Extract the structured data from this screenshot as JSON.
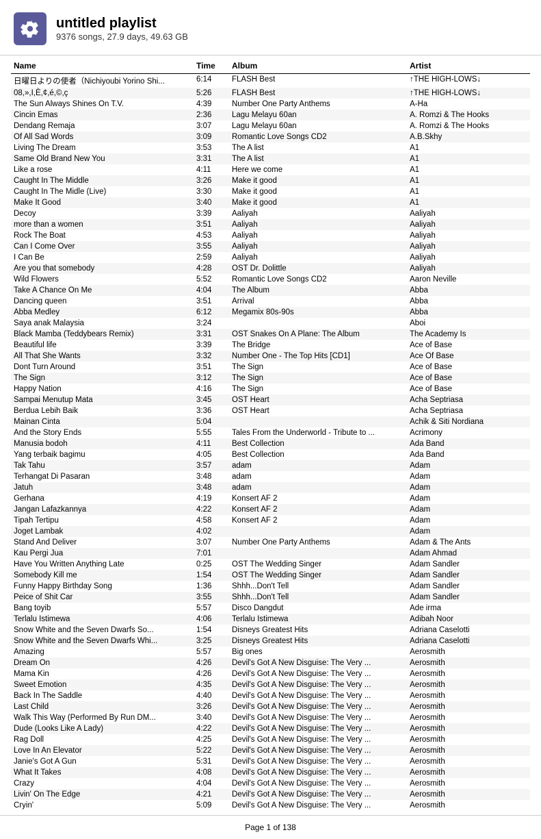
{
  "header": {
    "title": "untitled playlist",
    "subtitle": "9376 songs, 27.9 days, 49.63 GB"
  },
  "columns": {
    "name": "Name",
    "time": "Time",
    "album": "Album",
    "artist": "Artist"
  },
  "footer": "Page 1 of 138",
  "rows": [
    {
      "name": "日曜日よりの使者（Nichiyoubi Yorino Shi...",
      "time": "6:14",
      "album": "FLASH Best",
      "artist": "↑THE HIGH-LOWS↓"
    },
    {
      "name": "08,»,I,È,¢,é,©,ç",
      "time": "5:26",
      "album": "FLASH Best",
      "artist": "↑THE HIGH-LOWS↓"
    },
    {
      "name": "The Sun Always Shines On T.V.",
      "time": "4:39",
      "album": "Number One Party Anthems",
      "artist": "A-Ha"
    },
    {
      "name": "Cincin Emas",
      "time": "2:36",
      "album": "Lagu Melayu 60an",
      "artist": "A. Romzi & The Hooks"
    },
    {
      "name": "Dendang Remaja",
      "time": "3:07",
      "album": "Lagu Melayu 60an",
      "artist": "A. Romzi & The Hooks"
    },
    {
      "name": "Of All Sad Words",
      "time": "3:09",
      "album": "Romantic Love Songs CD2",
      "artist": "A.B.Skhy"
    },
    {
      "name": "Living The Dream",
      "time": "3:53",
      "album": "The A list",
      "artist": "A1"
    },
    {
      "name": "Same Old Brand New You",
      "time": "3:31",
      "album": "The A list",
      "artist": "A1"
    },
    {
      "name": "Like a rose",
      "time": "4:11",
      "album": "Here we come",
      "artist": "A1"
    },
    {
      "name": "Caught In The Middle",
      "time": "3:26",
      "album": "Make it good",
      "artist": "A1"
    },
    {
      "name": "Caught In The Midle (Live)",
      "time": "3:30",
      "album": "Make it good",
      "artist": "A1"
    },
    {
      "name": "Make It Good",
      "time": "3:40",
      "album": "Make it good",
      "artist": "A1"
    },
    {
      "name": "Decoy",
      "time": "3:39",
      "album": "Aaliyah",
      "artist": "Aaliyah"
    },
    {
      "name": "more than a women",
      "time": "3:51",
      "album": "Aaliyah",
      "artist": "Aaliyah"
    },
    {
      "name": "Rock The Boat",
      "time": "4:53",
      "album": "Aaliyah",
      "artist": "Aaliyah"
    },
    {
      "name": "Can I Come Over",
      "time": "3:55",
      "album": "Aaliyah",
      "artist": "Aaliyah"
    },
    {
      "name": "I Can Be",
      "time": "2:59",
      "album": "Aaliyah",
      "artist": "Aaliyah"
    },
    {
      "name": "Are you that somebody",
      "time": "4:28",
      "album": "OST Dr. Dolittle",
      "artist": "Aaliyah"
    },
    {
      "name": "Wild Flowers",
      "time": "5:52",
      "album": "Romantic Love Songs CD2",
      "artist": "Aaron Neville"
    },
    {
      "name": "Take A Chance On Me",
      "time": "4:04",
      "album": "The Album",
      "artist": "Abba"
    },
    {
      "name": "Dancing queen",
      "time": "3:51",
      "album": "Arrival",
      "artist": "Abba"
    },
    {
      "name": "Abba Medley",
      "time": "6:12",
      "album": "Megamix 80s-90s",
      "artist": "Abba"
    },
    {
      "name": "Saya anak Malaysia",
      "time": "3:24",
      "album": "",
      "artist": "Aboi"
    },
    {
      "name": "Black Mamba (Teddybears Remix)",
      "time": "3:31",
      "album": "OST Snakes On A Plane: The Album",
      "artist": "The Academy Is"
    },
    {
      "name": "Beautiful life",
      "time": "3:39",
      "album": "The Bridge",
      "artist": "Ace of Base"
    },
    {
      "name": "All That She Wants",
      "time": "3:32",
      "album": "Number One - The Top Hits [CD1]",
      "artist": "Ace Of Base"
    },
    {
      "name": "Dont Turn Around",
      "time": "3:51",
      "album": "The Sign",
      "artist": "Ace of Base"
    },
    {
      "name": "The Sign",
      "time": "3:12",
      "album": "The Sign",
      "artist": "Ace of Base"
    },
    {
      "name": "Happy Nation",
      "time": "4:16",
      "album": "The Sign",
      "artist": "Ace of Base"
    },
    {
      "name": "Sampai Menutup Mata",
      "time": "3:45",
      "album": "OST Heart",
      "artist": "Acha Septriasa"
    },
    {
      "name": "Berdua Lebih Baik",
      "time": "3:36",
      "album": "OST Heart",
      "artist": "Acha Septriasa"
    },
    {
      "name": "Mainan Cinta",
      "time": "5:04",
      "album": "",
      "artist": "Achik & Siti Nordiana"
    },
    {
      "name": "And the Story Ends",
      "time": "5:55",
      "album": "Tales From the Underworld - Tribute to ...",
      "artist": "Acrimony"
    },
    {
      "name": "Manusia bodoh",
      "time": "4:11",
      "album": "Best Collection",
      "artist": "Ada Band"
    },
    {
      "name": "Yang terbaik bagimu",
      "time": "4:05",
      "album": "Best Collection",
      "artist": "Ada Band"
    },
    {
      "name": "Tak Tahu",
      "time": "3:57",
      "album": "adam",
      "artist": "Adam"
    },
    {
      "name": "Terhangat Di Pasaran",
      "time": "3:48",
      "album": "adam",
      "artist": "Adam"
    },
    {
      "name": "Jatuh",
      "time": "3:48",
      "album": "adam",
      "artist": "Adam"
    },
    {
      "name": "Gerhana",
      "time": "4:19",
      "album": "Konsert AF 2",
      "artist": "Adam"
    },
    {
      "name": "Jangan Lafazkannya",
      "time": "4:22",
      "album": "Konsert AF 2",
      "artist": "Adam"
    },
    {
      "name": "Tipah Tertipu",
      "time": "4:58",
      "album": "Konsert AF 2",
      "artist": "Adam"
    },
    {
      "name": "Joget Lambak",
      "time": "4:02",
      "album": "",
      "artist": "Adam"
    },
    {
      "name": "Stand And Deliver",
      "time": "3:07",
      "album": "Number One Party Anthems",
      "artist": "Adam & The Ants"
    },
    {
      "name": "Kau Pergi Jua",
      "time": "7:01",
      "album": "",
      "artist": "Adam Ahmad"
    },
    {
      "name": "Have You Written Anything Late",
      "time": "0:25",
      "album": "OST The Wedding Singer",
      "artist": "Adam Sandler"
    },
    {
      "name": "Somebody Kill me",
      "time": "1:54",
      "album": "OST The Wedding Singer",
      "artist": "Adam Sandler"
    },
    {
      "name": "Funny Happy Birthday Song",
      "time": "1:36",
      "album": "Shhh...Don't Tell",
      "artist": "Adam Sandler"
    },
    {
      "name": "Peice of Shit Car",
      "time": "3:55",
      "album": "Shhh...Don't Tell",
      "artist": "Adam Sandler"
    },
    {
      "name": "Bang toyib",
      "time": "5:57",
      "album": "Disco Dangdut",
      "artist": "Ade irma"
    },
    {
      "name": "Terlalu Istimewa",
      "time": "4:06",
      "album": "Terlalu Istimewa",
      "artist": "Adibah Noor"
    },
    {
      "name": "Snow White and the Seven Dwarfs So...",
      "time": "1:54",
      "album": "Disneys Greatest Hits",
      "artist": "Adriana Caselotti"
    },
    {
      "name": "Snow White and the Seven Dwarfs Whi...",
      "time": "3:25",
      "album": "Disneys Greatest Hits",
      "artist": "Adriana Caselotti"
    },
    {
      "name": "Amazing",
      "time": "5:57",
      "album": "Big ones",
      "artist": "Aerosmith"
    },
    {
      "name": "Dream On",
      "time": "4:26",
      "album": "Devil's Got A New Disguise: The Very ...",
      "artist": "Aerosmith"
    },
    {
      "name": "Mama Kin",
      "time": "4:26",
      "album": "Devil's Got A New Disguise: The Very ...",
      "artist": "Aerosmith"
    },
    {
      "name": "Sweet Emotion",
      "time": "4:35",
      "album": "Devil's Got A New Disguise: The Very ...",
      "artist": "Aerosmith"
    },
    {
      "name": "Back In The Saddle",
      "time": "4:40",
      "album": "Devil's Got A New Disguise: The Very ...",
      "artist": "Aerosmith"
    },
    {
      "name": "Last Child",
      "time": "3:26",
      "album": "Devil's Got A New Disguise: The Very ...",
      "artist": "Aerosmith"
    },
    {
      "name": "Walk This Way (Performed By Run DM...",
      "time": "3:40",
      "album": "Devil's Got A New Disguise: The Very ...",
      "artist": "Aerosmith"
    },
    {
      "name": "Dude (Looks Like A Lady)",
      "time": "4:22",
      "album": "Devil's Got A New Disguise: The Very ...",
      "artist": "Aerosmith"
    },
    {
      "name": "Rag Doll",
      "time": "4:25",
      "album": "Devil's Got A New Disguise: The Very ...",
      "artist": "Aerosmith"
    },
    {
      "name": "Love In An Elevator",
      "time": "5:22",
      "album": "Devil's Got A New Disguise: The Very ...",
      "artist": "Aerosmith"
    },
    {
      "name": "Janie's Got A Gun",
      "time": "5:31",
      "album": "Devil's Got A New Disguise: The Very ...",
      "artist": "Aerosmith"
    },
    {
      "name": "What It Takes",
      "time": "4:08",
      "album": "Devil's Got A New Disguise: The Very ...",
      "artist": "Aerosmith"
    },
    {
      "name": "Crazy",
      "time": "4:04",
      "album": "Devil's Got A New Disguise: The Very ...",
      "artist": "Aerosmith"
    },
    {
      "name": "Livin' On The Edge",
      "time": "4:21",
      "album": "Devil's Got A New Disguise: The Very ...",
      "artist": "Aerosmith"
    },
    {
      "name": "Cryin'",
      "time": "5:09",
      "album": "Devil's Got A New Disguise: The Very ...",
      "artist": "Aerosmith"
    }
  ]
}
